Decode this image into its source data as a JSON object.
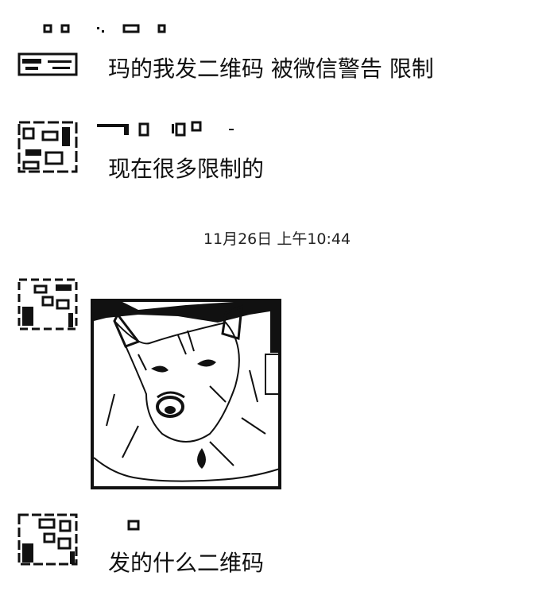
{
  "chat": {
    "top_nick_fragment": "",
    "messages": [
      {
        "text": "玛的我发二维码 被微信警告  限制"
      },
      {
        "text": "现在很多限制的"
      },
      {
        "text": "发的什么二维码"
      }
    ],
    "timestamp": "11月26日 上午10:44",
    "image_message": {
      "subject": "dog-photo"
    }
  },
  "colors": {
    "ink": "#111111",
    "background": "#ffffff"
  }
}
